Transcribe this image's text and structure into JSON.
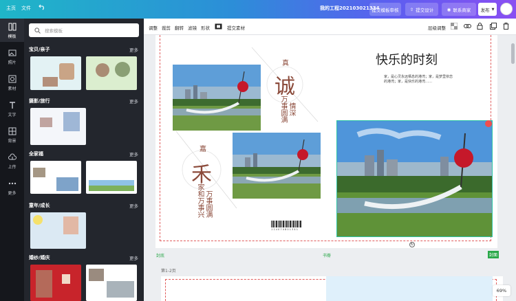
{
  "topbar": {
    "home": "主页",
    "file": "文件",
    "project_name": "我的工程202103021334",
    "submit_review": "提交模板审核",
    "submit_design": "提交设计",
    "contact": "联系商家",
    "publish": "发布"
  },
  "rail": [
    {
      "label": "模板"
    },
    {
      "label": "照片"
    },
    {
      "label": "素材"
    },
    {
      "label": "文字"
    },
    {
      "label": "背景"
    },
    {
      "label": "上传"
    },
    {
      "label": "更多"
    }
  ],
  "panel": {
    "search_placeholder": "搜索模板",
    "more": "更多",
    "sections": [
      {
        "title": "宝贝/亲子"
      },
      {
        "title": "摄影/旅行"
      },
      {
        "title": "全家福"
      },
      {
        "title": "童年/成长"
      },
      {
        "title": "婚纱/婚庆"
      }
    ]
  },
  "toolbar": {
    "items": [
      "调整",
      "裁剪",
      "翻转",
      "滤镜",
      "形状",
      "提交素材"
    ],
    "layer_adjust": "层级调整"
  },
  "canvas": {
    "title": "快乐的时刻",
    "body_text": "家，是心灵永远栖息的港湾；家，是梦里依恋的港湾；家，是快乐的港湾……",
    "char1": "真",
    "char_big1": "诚",
    "vt1a": "万事圆满",
    "vt1b": "情深",
    "char2": "嘉",
    "char_big2": "禾",
    "vt2a": "家和万事兴",
    "vt2b": "万事圆满",
    "barcode_text": "1 1 4 0 7 0 8 0 1 3 4 1",
    "label_cover": "封底",
    "label_spine": "书脊",
    "label_front": "封面",
    "page_label": "第1-2页"
  },
  "zoom": "69%"
}
